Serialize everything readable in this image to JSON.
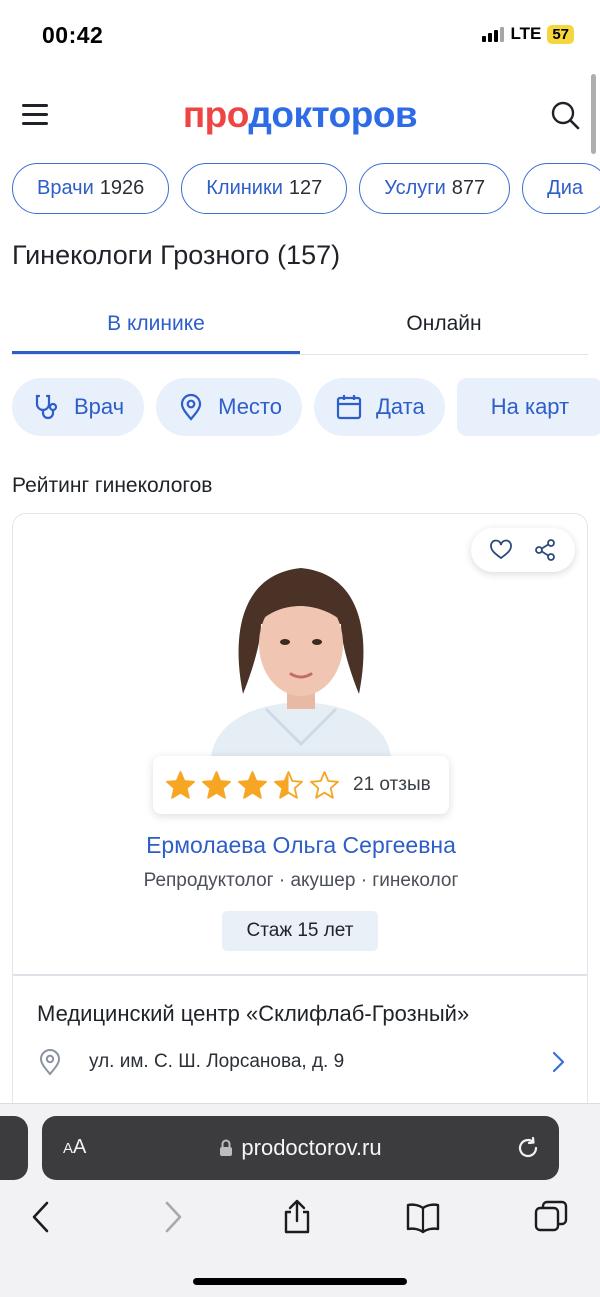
{
  "status": {
    "time": "00:42",
    "network": "LTE",
    "battery": "57"
  },
  "header": {
    "logo_part1": "про",
    "logo_part2": "докторов",
    "menu_icon": "hamburger-menu-icon",
    "search_icon": "search-icon"
  },
  "chips": [
    {
      "label": "Врачи",
      "count": "1926"
    },
    {
      "label": "Клиники",
      "count": "127"
    },
    {
      "label": "Услуги",
      "count": "877"
    },
    {
      "label": "Диа",
      "count": ""
    }
  ],
  "page_title": "Гинекологи Грозного (157)",
  "tabs": [
    {
      "label": "В клинике",
      "active": true
    },
    {
      "label": "Онлайн",
      "active": false
    }
  ],
  "filters": [
    {
      "label": "Врач",
      "icon": "stethoscope-icon"
    },
    {
      "label": "Место",
      "icon": "location-pin-icon"
    },
    {
      "label": "Дата",
      "icon": "calendar-icon"
    },
    {
      "label": "На карт",
      "icon": ""
    }
  ],
  "section_title": "Рейтинг гинекологов",
  "doctor": {
    "rating": 3.5,
    "rating_max": 5,
    "reviews": "21 отзыв",
    "name": "Ермолаева Ольга Сергеевна",
    "specialty": "Репродуктолог · акушер · гинеколог",
    "experience": "Стаж 15 лет",
    "clinic": "Медицинский центр «Склифлаб-Грозный»",
    "address": "ул. им. С. Ш. Лорсанова, д. 9"
  },
  "browser": {
    "aa_label": "AA",
    "url": "prodoctorov.ru"
  },
  "colors": {
    "accent": "#2e5ec9",
    "logo_red": "#ef4444",
    "star": "#f6a623"
  }
}
